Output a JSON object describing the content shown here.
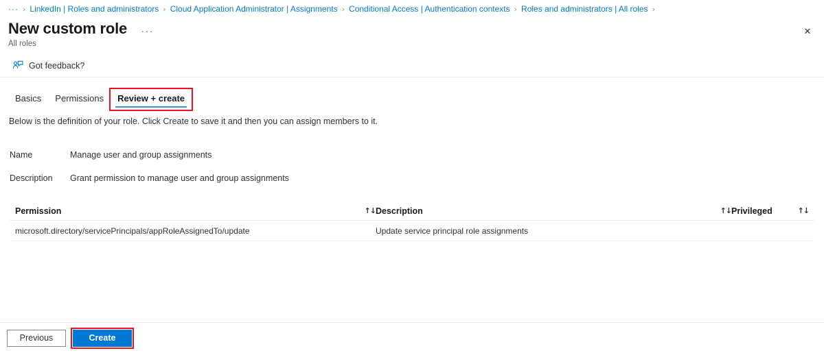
{
  "breadcrumb": {
    "overflow_label": "···",
    "separator": "›",
    "items": [
      {
        "label": "LinkedIn | Roles and administrators"
      },
      {
        "label": "Cloud Application Administrator | Assignments"
      },
      {
        "label": "Conditional Access | Authentication contexts"
      },
      {
        "label": "Roles and administrators | All roles"
      }
    ]
  },
  "header": {
    "title": "New custom role",
    "more_label": "···",
    "subtitle": "All roles",
    "close_label": "✕"
  },
  "commandbar": {
    "feedback_label": "Got feedback?",
    "feedback_icon": "feedback-person-icon"
  },
  "tabs": [
    {
      "label": "Basics",
      "active": false,
      "highlighted": false
    },
    {
      "label": "Permissions",
      "active": false,
      "highlighted": false
    },
    {
      "label": "Review + create",
      "active": true,
      "highlighted": true
    }
  ],
  "main": {
    "intro": "Below is the definition of your role. Click Create to save it and then you can assign members to it.",
    "fields": [
      {
        "label": "Name",
        "value": "Manage user and group assignments"
      },
      {
        "label": "Description",
        "value": "Grant permission to manage user and group assignments"
      }
    ],
    "table": {
      "sort_icon": "↑↓",
      "columns": [
        {
          "header": "Permission",
          "sortable": true
        },
        {
          "header": "Description",
          "sortable": true
        },
        {
          "header": "Privileged",
          "sortable": true
        }
      ],
      "rows": [
        {
          "permission": "microsoft.directory/servicePrincipals/appRoleAssignedTo/update",
          "description": "Update service principal role assignments",
          "privileged": ""
        }
      ]
    }
  },
  "footer": {
    "previous_label": "Previous",
    "create_label": "Create",
    "create_highlighted": true
  },
  "colors": {
    "accent": "#0078d4",
    "link": "#0078d4",
    "tab_underline": "#3a96dd",
    "highlight_box": "#e81123",
    "text_primary": "#323130",
    "text_secondary": "#605e5c",
    "divider": "#edebe9"
  }
}
